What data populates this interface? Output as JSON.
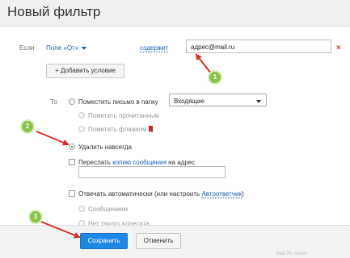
{
  "dialog": {
    "title": "Новый фильтр"
  },
  "condition": {
    "if_label": "Если",
    "field_select": "Поле «От»",
    "operator_link": "содержит",
    "value": "адрес@mail.ru",
    "add_condition_label": "Добавить условие"
  },
  "actions": {
    "then_label": "То",
    "move_to_folder": "Поместить письмо в папку",
    "folder_select": "Входящие",
    "mark_read": "Пометить прочитанным",
    "mark_flag": "Пометить флажком",
    "delete_forever": "Удалить навсегда",
    "forward_prefix": "Переслать",
    "forward_link": "копию сообщения",
    "forward_suffix": "на адрес",
    "auto_reply_prefix": "Отвечать автоматически (или настроить",
    "auto_reply_link": "Автоответчик",
    "auto_reply_suffix": ")",
    "reply_message": "Сообщением",
    "no_such_address": "Нет такого адресата"
  },
  "buttons": {
    "save": "Сохранить",
    "cancel": "Отменить"
  },
  "footer": {
    "partial_text": "Mail.Ru Агент"
  },
  "annotations": [
    "1",
    "2",
    "3"
  ],
  "colors": {
    "primary": "#1e88e5",
    "marker": "#8bc34a",
    "arrow": "#d32f2f",
    "link": "#1a5fb4"
  }
}
